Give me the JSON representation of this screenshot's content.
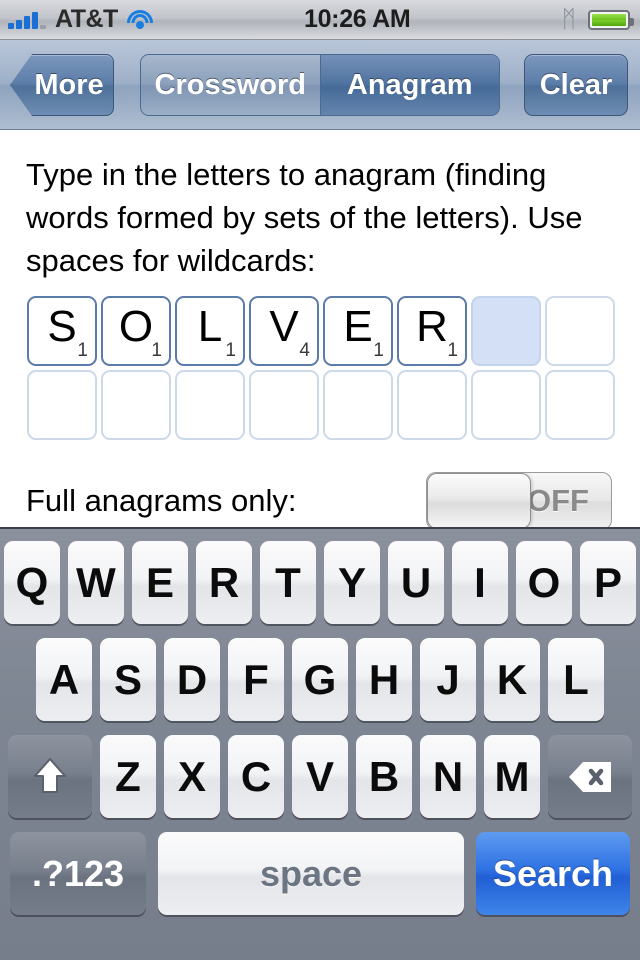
{
  "status_bar": {
    "carrier": "AT&T",
    "time": "10:26 AM",
    "signal_icon": "signal-bars-icon",
    "signal_bars_filled": 4,
    "signal_bars_total": 5,
    "wifi_icon": "wifi-icon",
    "bluetooth_icon": "bluetooth-icon",
    "bluetooth_glyph": "ᛗ",
    "battery_icon": "battery-icon",
    "battery_level_percent": 100,
    "battery_color": "#6dc11e"
  },
  "nav_bar": {
    "back_label": "More",
    "clear_label": "Clear",
    "segments": [
      {
        "label": "Crossword",
        "selected": false
      },
      {
        "label": "Anagram",
        "selected": true
      }
    ],
    "selected_segment": "Anagram",
    "accent_color": "#4f73a0"
  },
  "main": {
    "instructions": "Type in the letters to anagram (finding words formed by sets of the letters). Use spaces for wildcards:",
    "tiles_row1": [
      {
        "letter": "S",
        "points": "1",
        "state": "filled"
      },
      {
        "letter": "O",
        "points": "1",
        "state": "filled"
      },
      {
        "letter": "L",
        "points": "1",
        "state": "filled"
      },
      {
        "letter": "V",
        "points": "4",
        "state": "filled"
      },
      {
        "letter": "E",
        "points": "1",
        "state": "filled"
      },
      {
        "letter": "R",
        "points": "1",
        "state": "filled"
      },
      {
        "letter": "",
        "points": "",
        "state": "active"
      },
      {
        "letter": "",
        "points": "",
        "state": "empty"
      }
    ],
    "tiles_row2": [
      {
        "letter": "",
        "points": "",
        "state": "empty"
      },
      {
        "letter": "",
        "points": "",
        "state": "empty"
      },
      {
        "letter": "",
        "points": "",
        "state": "empty"
      },
      {
        "letter": "",
        "points": "",
        "state": "empty"
      },
      {
        "letter": "",
        "points": "",
        "state": "empty"
      },
      {
        "letter": "",
        "points": "",
        "state": "empty"
      },
      {
        "letter": "",
        "points": "",
        "state": "empty"
      },
      {
        "letter": "",
        "points": "",
        "state": "empty"
      }
    ],
    "entered_word": "SOLVER",
    "toggle_label": "Full anagrams only:",
    "toggle_value": "OFF",
    "toggle_on": false,
    "active_tile_color": "#d3e0f5"
  },
  "keyboard": {
    "row1": [
      "Q",
      "W",
      "E",
      "R",
      "T",
      "Y",
      "U",
      "I",
      "O",
      "P"
    ],
    "row2": [
      "A",
      "S",
      "D",
      "F",
      "G",
      "H",
      "J",
      "K",
      "L"
    ],
    "row3": [
      "Z",
      "X",
      "C",
      "V",
      "B",
      "N",
      "M"
    ],
    "shift_icon": "shift-icon",
    "delete_icon": "backspace-icon",
    "numeric_label": ".?123",
    "space_label": "space",
    "return_label": "Search",
    "return_color": "#2f72e3"
  }
}
